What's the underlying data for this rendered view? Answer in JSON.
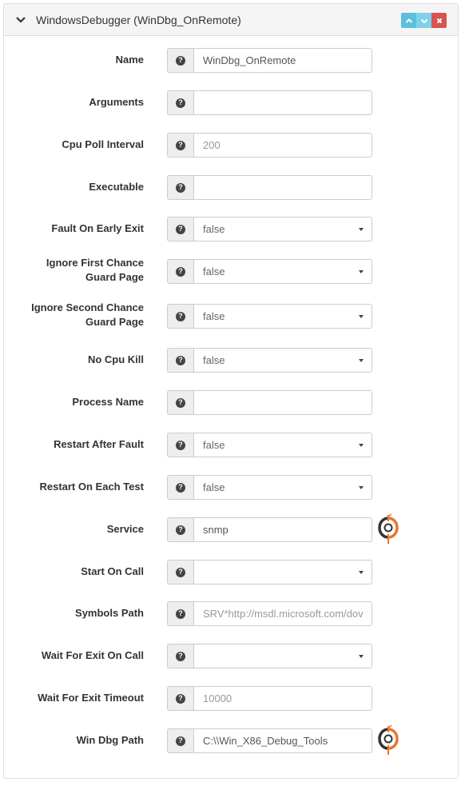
{
  "panel": {
    "title": "WindowsDebugger (WinDbg_OnRemote)",
    "collapse_icon": "chevron-down-icon",
    "buttons": {
      "up_icon": "chevron-up-icon",
      "down_icon": "chevron-down-icon",
      "close_icon": "close-icon"
    }
  },
  "fields": {
    "name": {
      "label": "Name",
      "value": "WinDbg_OnRemote"
    },
    "arguments": {
      "label": "Arguments",
      "value": ""
    },
    "cpu_poll_interval": {
      "label": "Cpu Poll Interval",
      "placeholder": "200"
    },
    "executable": {
      "label": "Executable",
      "value": ""
    },
    "fault_on_early_exit": {
      "label": "Fault On Early Exit",
      "selected": "false"
    },
    "ignore_first_chance_guard_page": {
      "label_line1": "Ignore First Chance",
      "label_line2": "Guard Page",
      "selected": "false"
    },
    "ignore_second_chance_guard_page": {
      "label_line1": "Ignore Second Chance",
      "label_line2": "Guard Page",
      "selected": "false"
    },
    "no_cpu_kill": {
      "label": "No Cpu Kill",
      "selected": "false"
    },
    "process_name": {
      "label": "Process Name",
      "value": ""
    },
    "restart_after_fault": {
      "label": "Restart After Fault",
      "selected": "false"
    },
    "restart_on_each_test": {
      "label": "Restart On Each Test",
      "selected": "false"
    },
    "service": {
      "label": "Service",
      "value": "snmp"
    },
    "start_on_call": {
      "label": "Start On Call",
      "selected": ""
    },
    "symbols_path": {
      "label": "Symbols Path",
      "placeholder": "SRV*http://msdl.microsoft.com/dov"
    },
    "wait_for_exit_on_call": {
      "label": "Wait For Exit On Call",
      "selected": ""
    },
    "wait_for_exit_timeout": {
      "label": "Wait For Exit Timeout",
      "placeholder": "10000"
    },
    "win_dbg_path": {
      "label": "Win Dbg Path",
      "value": "C:\\\\Win_X86_Debug_Tools"
    }
  },
  "help_icon_glyph": "?",
  "colors": {
    "up_button": "#5bc0de",
    "down_button": "#7dd1ea",
    "close_button": "#d9534f",
    "logo_orange": "#e8782c",
    "logo_dark": "#333333"
  }
}
